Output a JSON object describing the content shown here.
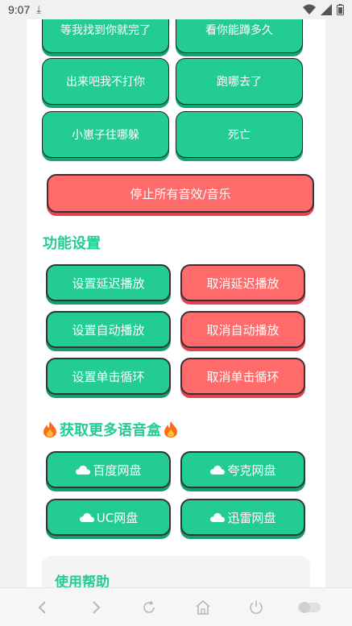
{
  "status": {
    "time": "9:07"
  },
  "sounds": [
    "等我找到你就完了",
    "看你能蹲多久",
    "出来吧我不打你",
    "跑哪去了",
    "小崽子往哪躲",
    "死亡"
  ],
  "stop_all": "停止所有音效/音乐",
  "features": {
    "title": "功能设置",
    "buttons": [
      {
        "label": "设置延迟播放",
        "color": "green"
      },
      {
        "label": "取消延迟播放",
        "color": "red"
      },
      {
        "label": "设置自动播放",
        "color": "green"
      },
      {
        "label": "取消自动播放",
        "color": "red"
      },
      {
        "label": "设置单击循环",
        "color": "green"
      },
      {
        "label": "取消单击循环",
        "color": "red"
      }
    ]
  },
  "more": {
    "title": "获取更多语音盒",
    "disks": [
      "百度网盘",
      "夸克网盘",
      "UC网盘",
      "迅雷网盘"
    ]
  },
  "help": {
    "title": "使用帮助"
  },
  "colors": {
    "accent": "#22cc94",
    "danger": "#ff6b6b"
  }
}
